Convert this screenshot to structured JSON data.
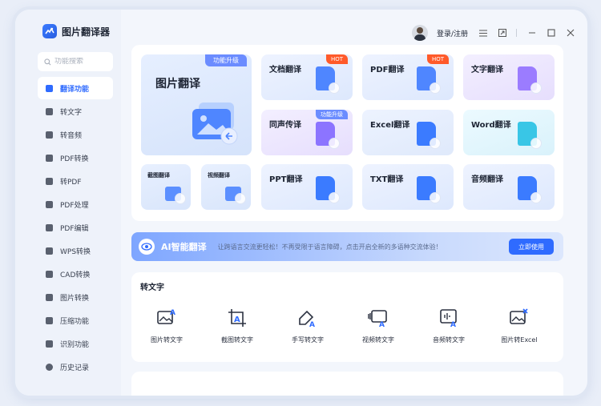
{
  "app": {
    "name": "图片翻译器"
  },
  "search": {
    "placeholder": "功能搜索"
  },
  "sidebar": {
    "items": [
      {
        "label": "翻译功能",
        "active": true
      },
      {
        "label": "转文字"
      },
      {
        "label": "转音频"
      },
      {
        "label": "PDF转换"
      },
      {
        "label": "转PDF"
      },
      {
        "label": "PDF处理"
      },
      {
        "label": "PDF编辑"
      },
      {
        "label": "WPS转换"
      },
      {
        "label": "CAD转换"
      },
      {
        "label": "图片转换"
      },
      {
        "label": "压缩功能"
      },
      {
        "label": "识别功能"
      },
      {
        "label": "历史记录"
      }
    ]
  },
  "topbar": {
    "login_label": "登录/注册"
  },
  "translate": {
    "feature_card": {
      "title": "图片翻译",
      "badge": "功能升级"
    },
    "small_cards": [
      {
        "title": "截图翻译"
      },
      {
        "title": "视频翻译"
      }
    ],
    "cards": [
      {
        "title": "文档翻译",
        "badge": "HOT",
        "badge_type": "hot"
      },
      {
        "title": "PDF翻译",
        "badge": "HOT",
        "badge_type": "hot"
      },
      {
        "title": "文字翻译"
      },
      {
        "title": "同声传译",
        "badge": "功能升级",
        "badge_type": "up"
      },
      {
        "title": "Excel翻译"
      },
      {
        "title": "Word翻译"
      },
      {
        "title": "PPT翻译"
      },
      {
        "title": "TXT翻译"
      },
      {
        "title": "音频翻译"
      }
    ]
  },
  "ai_banner": {
    "title": "AI智能翻译",
    "desc": "让跨语言交流更轻松！不再受限于语言障碍，点击开启全新的多语种交流体验！",
    "button": "立即使用"
  },
  "text_section": {
    "title": "转文字",
    "tools": [
      {
        "label": "图片转文字",
        "icon": "image-to-text-icon"
      },
      {
        "label": "截图转文字",
        "icon": "screenshot-to-text-icon"
      },
      {
        "label": "手写转文字",
        "icon": "handwriting-to-text-icon"
      },
      {
        "label": "视频转文字",
        "icon": "video-to-text-icon"
      },
      {
        "label": "音频转文字",
        "icon": "audio-to-text-icon"
      },
      {
        "label": "图片转Excel",
        "icon": "image-to-excel-icon"
      }
    ]
  }
}
